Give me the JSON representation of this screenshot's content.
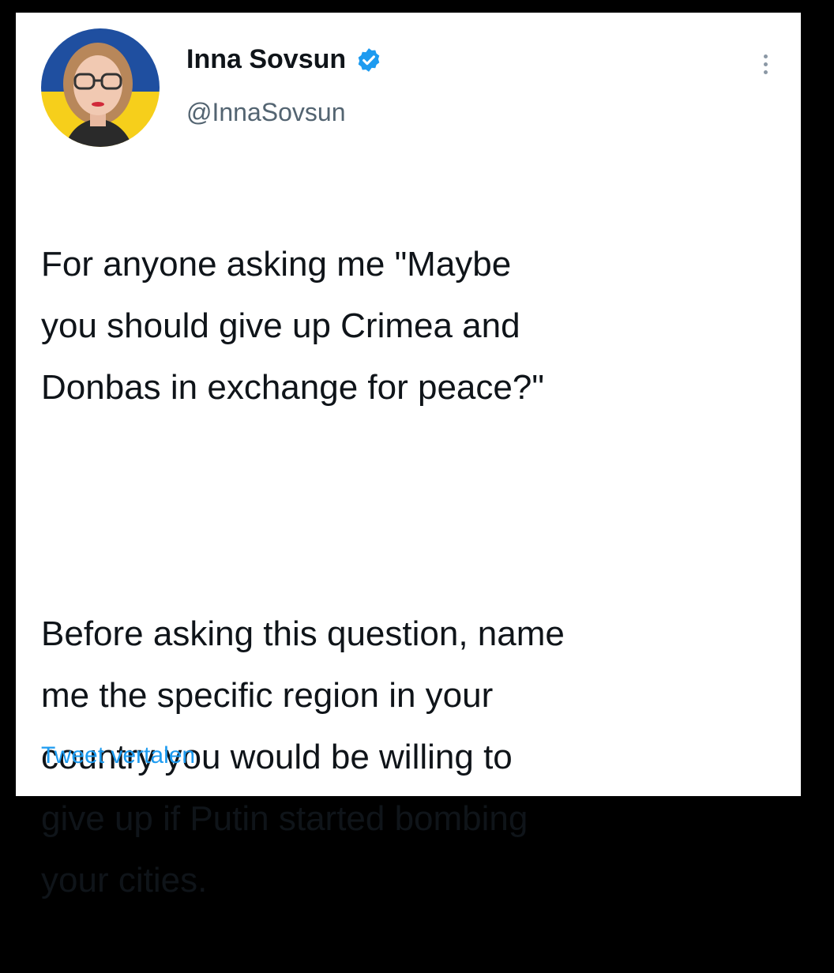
{
  "tweet": {
    "author": {
      "display_name": "Inna Sovsun",
      "handle": "@InnaSovsun",
      "verified": true,
      "avatar": "profile-photo-with-ukrainian-flag-background"
    },
    "paragraphs": [
      "For anyone asking me \"Maybe\nyou should give up Crimea and\nDonbas in exchange for peace?\"",
      "Before asking this question, name\nme the specific region in your\ncountry you would be willing to\ngive up if Putin started bombing\nyour cities."
    ],
    "translate_label": "Tweet vertalen"
  },
  "icons": {
    "verified": "verified-badge-icon",
    "more": "more-options-icon"
  },
  "colors": {
    "background": "#000000",
    "card": "#ffffff",
    "text": "#0f1419",
    "secondary_text": "#536471",
    "link": "#1d9bf0",
    "flag_blue": "#1f4fa0",
    "flag_yellow": "#f6cf1b"
  }
}
